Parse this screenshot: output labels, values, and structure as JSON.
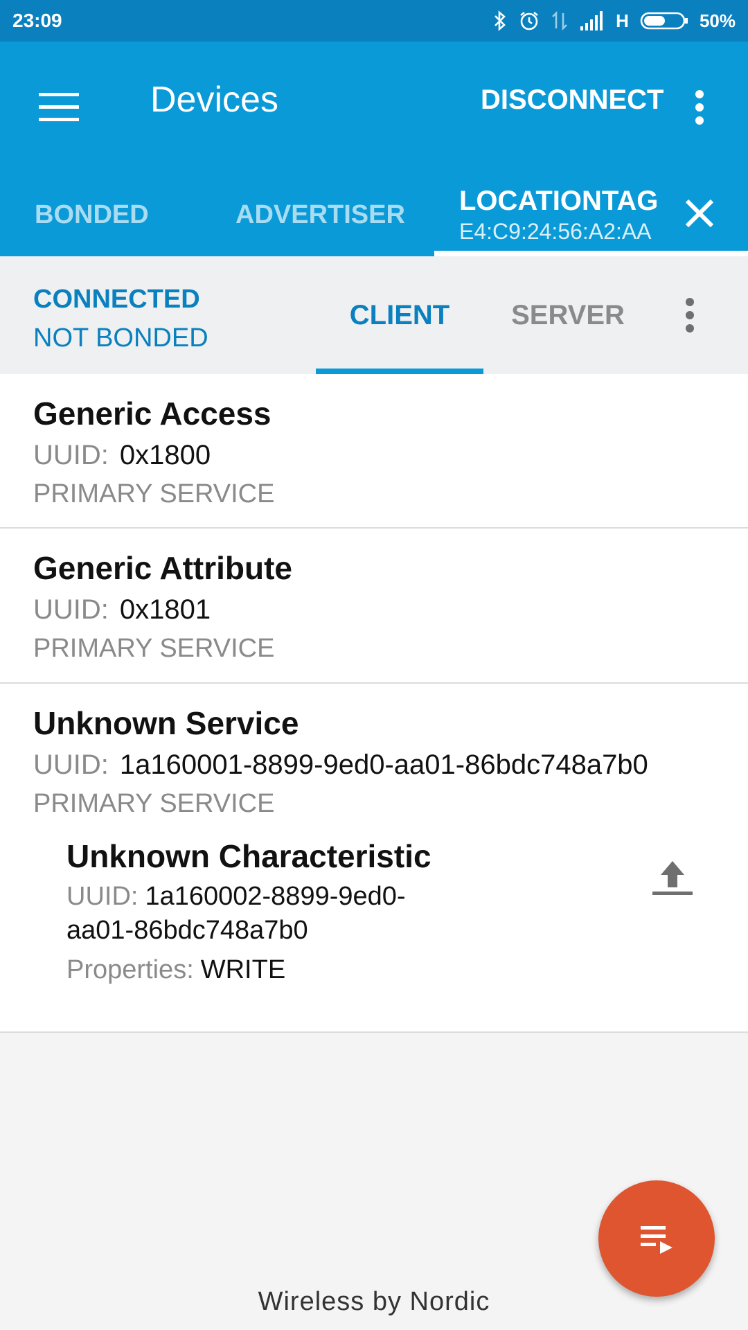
{
  "status_bar": {
    "time": "23:09",
    "network": "H",
    "battery": "50%"
  },
  "app_bar": {
    "title": "Devices",
    "disconnect_label": "DISCONNECT"
  },
  "tabs": {
    "bonded": "BONDED",
    "advertiser": "ADVERTISER",
    "device_name": "LOCATIONTAG",
    "device_mac": "E4:C9:24:56:A2:AA"
  },
  "connection": {
    "state": "CONNECTED",
    "bond": "NOT BONDED",
    "client_label": "CLIENT",
    "server_label": "SERVER"
  },
  "services": [
    {
      "name": "Generic Access",
      "uuid_label": "UUID:",
      "uuid": "0x1800",
      "type": "PRIMARY SERVICE"
    },
    {
      "name": "Generic Attribute",
      "uuid_label": "UUID:",
      "uuid": "0x1801",
      "type": "PRIMARY SERVICE"
    },
    {
      "name": "Unknown Service",
      "uuid_label": "UUID:",
      "uuid": "1a160001-8899-9ed0-aa01-86bdc748a7b0",
      "type": "PRIMARY SERVICE"
    }
  ],
  "characteristic": {
    "name": "Unknown Characteristic",
    "uuid_label": "UUID:",
    "uuid": "1a160002-8899-9ed0-aa01-86bdc748a7b0",
    "properties_label": "Properties:",
    "properties": "WRITE"
  },
  "footer": "Wireless by Nordic",
  "colors": {
    "primary": "#0a9ad8",
    "primary_dark": "#0a80bf",
    "fab": "#de5530"
  }
}
